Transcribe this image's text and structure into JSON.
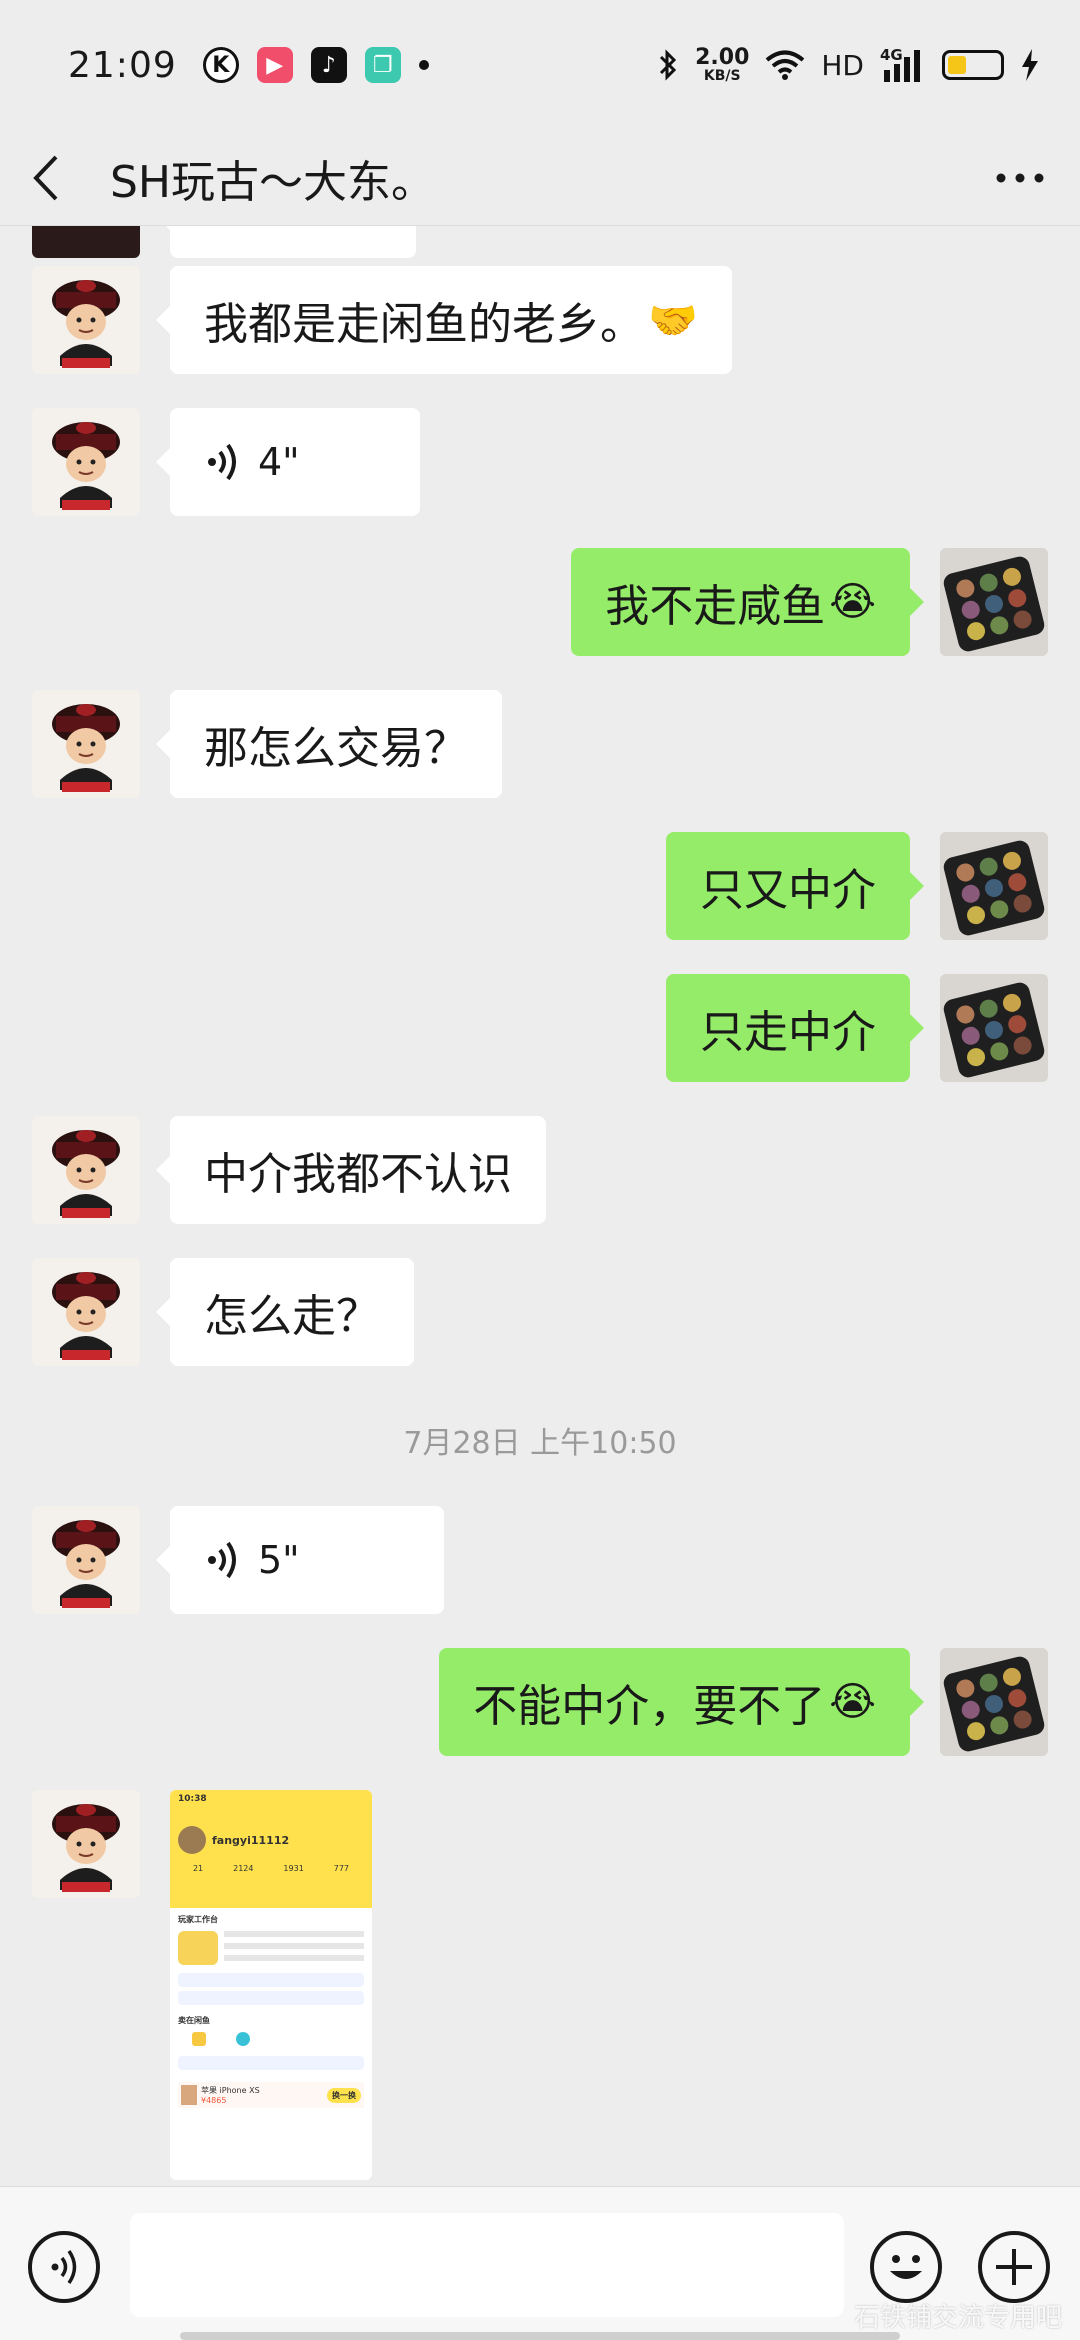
{
  "status_bar": {
    "time": "21:09",
    "net_speed_value": "2.00",
    "net_speed_unit": "KB/S",
    "hd_label": "HD",
    "signal_label": "4G",
    "battery_level": 0.35,
    "app_icons": [
      "k-app-icon",
      "video-app-icon",
      "tiktok-icon",
      "gallery-app-icon"
    ]
  },
  "nav": {
    "title": "SH玩古～大东。"
  },
  "messages": [
    {
      "side": "left",
      "type": "text",
      "text": "我都是走闲鱼的老乡。",
      "emoji": "🤝"
    },
    {
      "side": "left",
      "type": "voice",
      "duration": "4\""
    },
    {
      "side": "right",
      "type": "text",
      "text": "我不走咸鱼",
      "emoji": "😭"
    },
    {
      "side": "left",
      "type": "text",
      "text": "那怎么交易？"
    },
    {
      "side": "right",
      "type": "text",
      "text": "只又中介"
    },
    {
      "side": "right",
      "type": "text",
      "text": "只走中介"
    },
    {
      "side": "left",
      "type": "text",
      "text": "中介我都不认识"
    },
    {
      "side": "left",
      "type": "text",
      "text": "怎么走？"
    },
    {
      "side": "time",
      "text": "7月28日 上午10:50"
    },
    {
      "side": "left",
      "type": "voice",
      "duration": "5\""
    },
    {
      "side": "right",
      "type": "text",
      "text": "不能中介，要不了",
      "emoji": "😭"
    },
    {
      "side": "left",
      "type": "image"
    }
  ],
  "image_preview": {
    "time": "10:38",
    "username": "fangyi11112",
    "stats": [
      "21",
      "2124",
      "1931",
      "777"
    ],
    "section1": "玩家工作台",
    "section2": "卖在闲鱼",
    "item_name": "苹果 iPhone XS",
    "item_price": "¥4865",
    "item_btn": "换一换"
  },
  "input_bar": {
    "watermark": "石铁铺交流专用吧"
  },
  "colors": {
    "background": "#ededed",
    "bubble_self": "#95ec69",
    "bubble_other": "#ffffff",
    "timestamp": "#9a9a9a"
  }
}
